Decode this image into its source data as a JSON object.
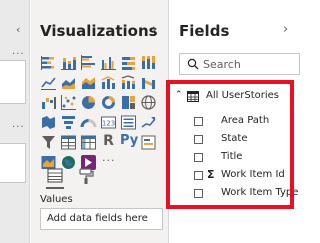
{
  "filters_pane": {
    "collapse_glyph": "‹",
    "more_glyph_1": "···",
    "more_glyph_2": "···"
  },
  "visualizations": {
    "title": "Visualizations",
    "collapse_glyph": "›",
    "icons": [
      "stacked-bar-chart-icon",
      "stacked-column-chart-icon",
      "clustered-bar-chart-icon",
      "clustered-column-chart-icon",
      "100-percent-bar-chart-icon",
      "100-percent-column-chart-icon",
      "line-chart-icon",
      "area-chart-icon",
      "stacked-area-chart-icon",
      "line-column-chart-icon",
      "line-stacked-column-chart-icon",
      "ribbon-chart-icon",
      "waterfall-chart-icon",
      "scatter-chart-icon",
      "pie-chart-icon",
      "donut-chart-icon",
      "treemap-icon",
      "map-icon",
      "filled-map-icon",
      "funnel-chart-icon",
      "gauge-icon",
      "card-icon",
      "multi-row-card-icon",
      "kpi-icon",
      "slicer-icon",
      "table-icon",
      "matrix-icon",
      "r-visual-icon",
      "python-visual-icon",
      "key-influencers-icon",
      "arcgis-map-icon",
      "globe-icon",
      "power-apps-icon",
      "more-visuals-icon"
    ],
    "r_glyph": "R",
    "py_glyph": "Py",
    "more_glyph": "···",
    "values_label": "Values",
    "values_placeholder": "Add data fields here"
  },
  "fields": {
    "title": "Fields",
    "collapse_glyph": "›",
    "search_placeholder": "Search",
    "table": {
      "expand_glyph": "⌃",
      "name": "All UserStories",
      "fields": [
        {
          "name": "Area Path",
          "sigma": ""
        },
        {
          "name": "State",
          "sigma": ""
        },
        {
          "name": "Title",
          "sigma": ""
        },
        {
          "name": "Work Item Id",
          "sigma": "Σ"
        },
        {
          "name": "Work Item Type",
          "sigma": ""
        }
      ]
    }
  },
  "colors": {
    "highlight": "#e81123",
    "pane_bg": "#f3f2f1",
    "accent_yellow": "#e8a33d",
    "accent_blue": "#3a6ea5",
    "accent_purple": "#742774"
  }
}
